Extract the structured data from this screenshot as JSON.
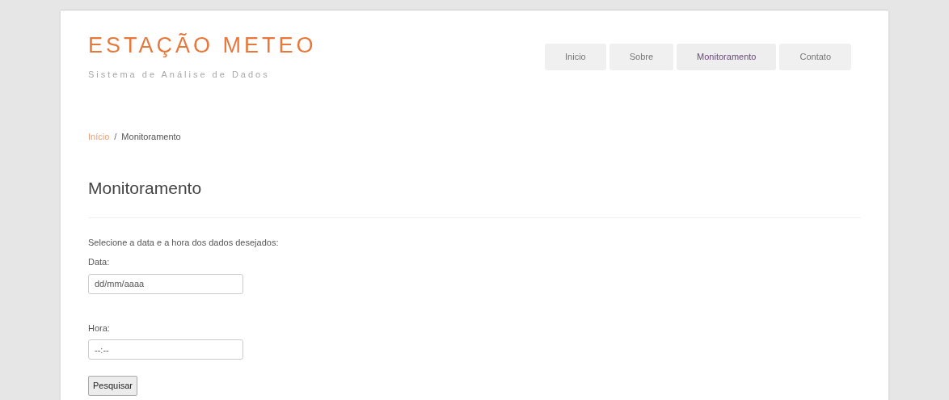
{
  "logo": {
    "title": "ESTAÇÃO METEO",
    "subtitle": "Sistema de Análise de Dados"
  },
  "nav": [
    {
      "label": "Inicio",
      "selected": false
    },
    {
      "label": "Sobre",
      "selected": false
    },
    {
      "label": "Monitoramento",
      "selected": true
    },
    {
      "label": "Contato",
      "selected": false
    }
  ],
  "breadcrumb": {
    "link": "Início",
    "separator": "/",
    "current": "Monitoramento"
  },
  "heading": "Monitoramento",
  "form": {
    "instruction": "Selecione a data e a hora dos dados desejados:",
    "fields": [
      {
        "label": "Data:",
        "placeholder": "dd/mm/aaaa"
      },
      {
        "label": "Hora:",
        "placeholder": "--:--"
      }
    ],
    "button": "Pesquisar"
  }
}
